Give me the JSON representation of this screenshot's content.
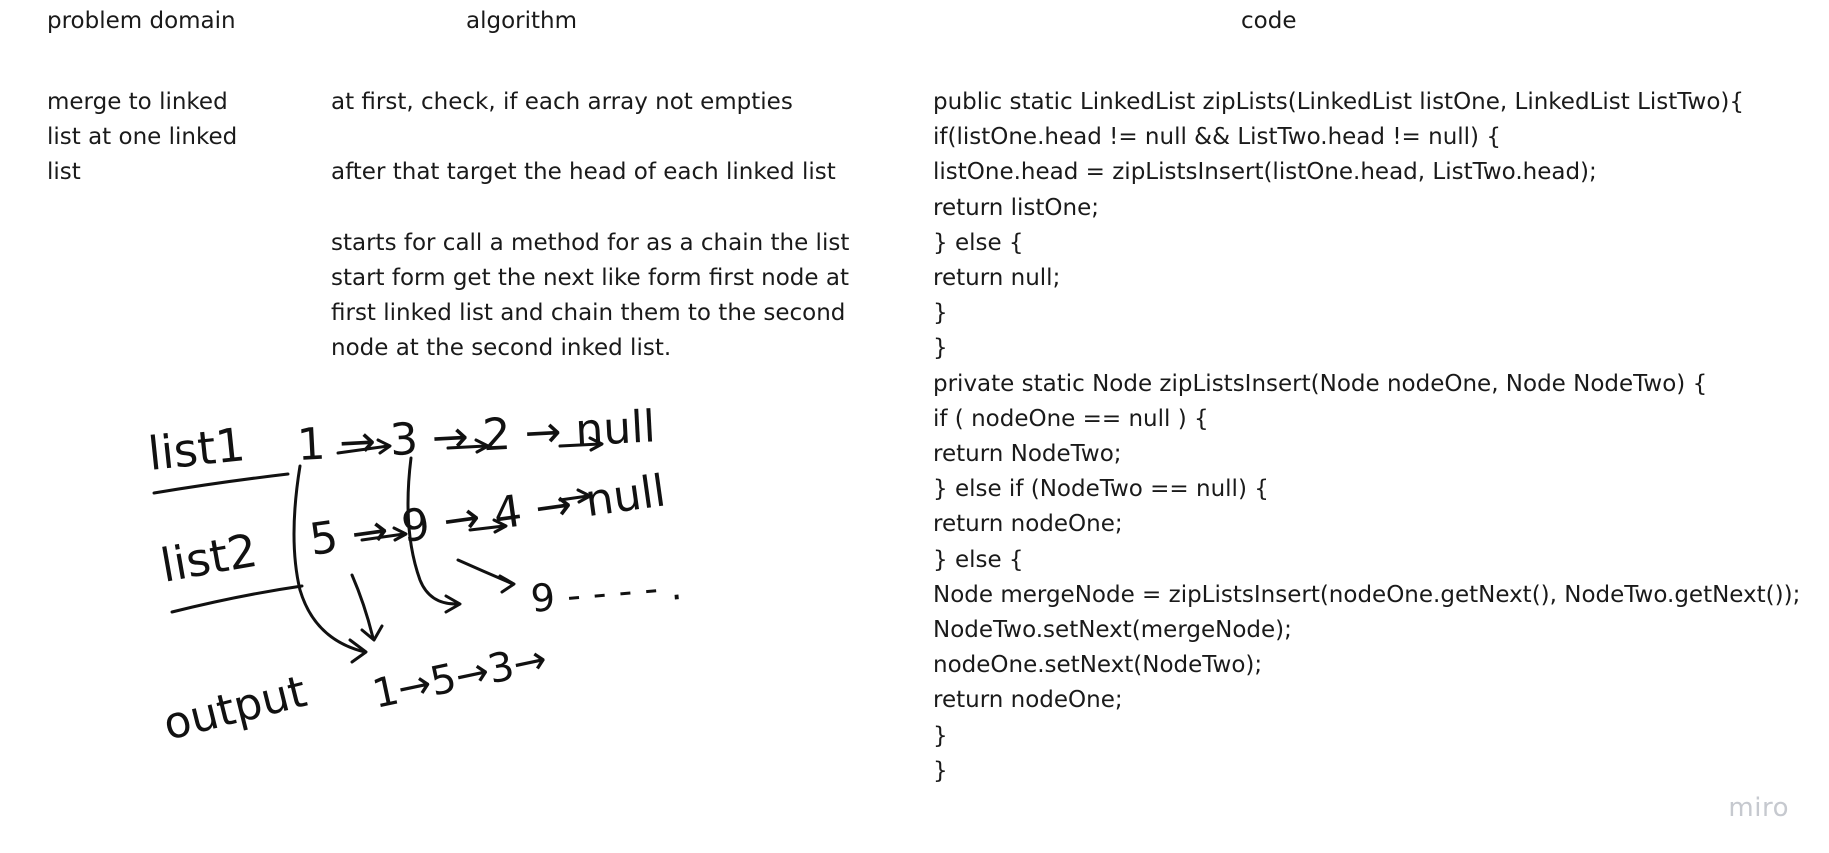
{
  "headings": {
    "problem": "problem domain",
    "algorithm": "algorithm",
    "code": "code"
  },
  "problem_text": [
    "merge to linked",
    "list at one linked",
    "list"
  ],
  "algorithm_text": [
    "at first, check, if each array not empties",
    "",
    "after that target the head of each linked list",
    "",
    "starts for call a method for as a chain the list",
    "start form get the next like form first node at",
    "first linked list and chain them to the second",
    "node at the second inked list."
  ],
  "code_lines": [
    "public static LinkedList zipLists(LinkedList listOne, LinkedList ListTwo){",
    " if(listOne.head != null && ListTwo.head != null) {",
    "   listOne.head = zipListsInsert(listOne.head, ListTwo.head);",
    "   return listOne;",
    "  } else {",
    "   return null;",
    "  }",
    "}",
    "",
    "private static Node zipListsInsert(Node nodeOne, Node NodeTwo) {",
    "  if ( nodeOne == null ) {",
    "   return NodeTwo;",
    "  } else if (NodeTwo == null) {",
    "   return nodeOne;",
    "  } else {",
    "   Node mergeNode = zipListsInsert(nodeOne.getNext(), NodeTwo.getNext());",
    "   NodeTwo.setNext(mergeNode);",
    "   nodeOne.setNext(NodeTwo);",
    "   return nodeOne;",
    "  }",
    "}"
  ],
  "sketch": {
    "list1_label": "list1",
    "list1_nodes": "1 → 3 → 2 → null",
    "list2_label": "list2",
    "list2_nodes": "5 → 9 → 4 → null",
    "output_label": "output",
    "output_nodes": "1→5→3→",
    "trail": "9 - - - - ."
  },
  "watermark": "miro"
}
